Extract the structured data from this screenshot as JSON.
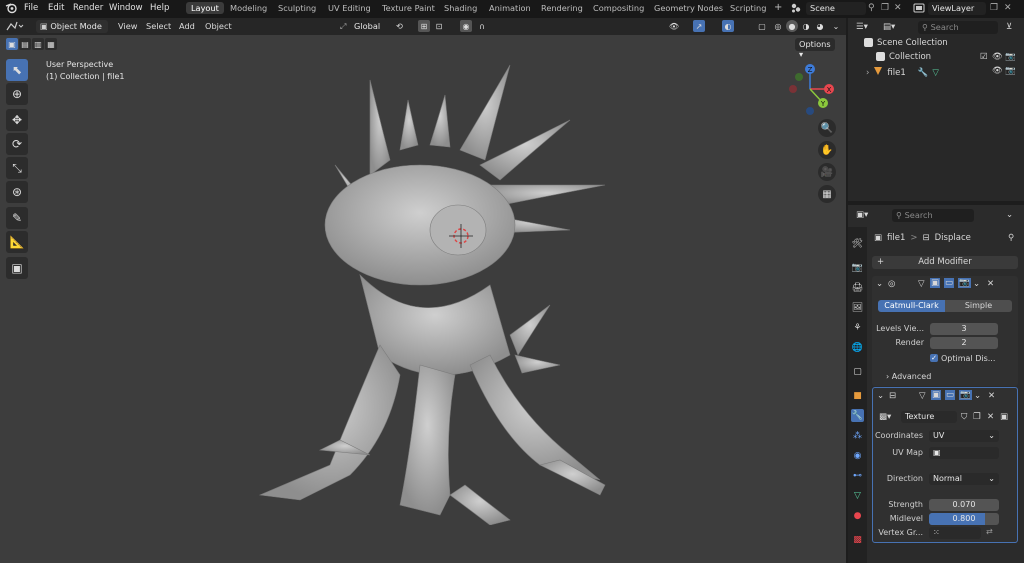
{
  "menu": {
    "items": [
      "File",
      "Edit",
      "Render",
      "Window",
      "Help"
    ]
  },
  "workspaces": {
    "items": [
      "Layout",
      "Modeling",
      "Sculpting",
      "UV Editing",
      "Texture Paint",
      "Shading",
      "Animation",
      "Rendering",
      "Compositing",
      "Geometry Nodes",
      "Scripting"
    ],
    "active": "Layout",
    "add": "+"
  },
  "scene": {
    "name": "Scene",
    "view_layer": "ViewLayer"
  },
  "viewport_header": {
    "mode": "Object Mode",
    "view": "View",
    "select": "Select",
    "add": "Add",
    "object": "Object",
    "orientation": "Global",
    "options": "Options"
  },
  "viewport": {
    "perspective": "User Perspective",
    "collection_info": "(1) Collection | file1"
  },
  "gizmo": {
    "x": "X",
    "y": "Y",
    "z": "Z"
  },
  "outliner": {
    "search_placeholder": "Search",
    "scene_collection": "Scene Collection",
    "collection": "Collection",
    "object": "file1"
  },
  "properties": {
    "search_placeholder": "Search",
    "breadcrumb_object": "file1",
    "breadcrumb_sep": ">",
    "breadcrumb_modifier": "Displace",
    "add_modifier": "Add Modifier",
    "subsurf": {
      "tab_catmull": "Catmull-Clark",
      "tab_simple": "Simple",
      "levels_label": "Levels Vie...",
      "levels_value": "3",
      "render_label": "Render",
      "render_value": "2",
      "optimal_label": "Optimal Dis...",
      "advanced_label": "Advanced"
    },
    "displace": {
      "texture_value": "Texture",
      "coordinates_label": "Coordinates",
      "coordinates_value": "UV",
      "uvmap_label": "UV Map",
      "direction_label": "Direction",
      "direction_value": "Normal",
      "strength_label": "Strength",
      "strength_value": "0.070",
      "midlevel_label": "Midlevel",
      "midlevel_value": "0.800",
      "midlevel_fraction": 0.8,
      "vertexgroup_label": "Vertex Gr..."
    }
  },
  "colors": {
    "accent": "#4772b3",
    "axis_x": "#e8464e",
    "axis_y": "#8bc83c",
    "axis_z": "#3d7bd9",
    "object_orange": "#e69a3c"
  }
}
